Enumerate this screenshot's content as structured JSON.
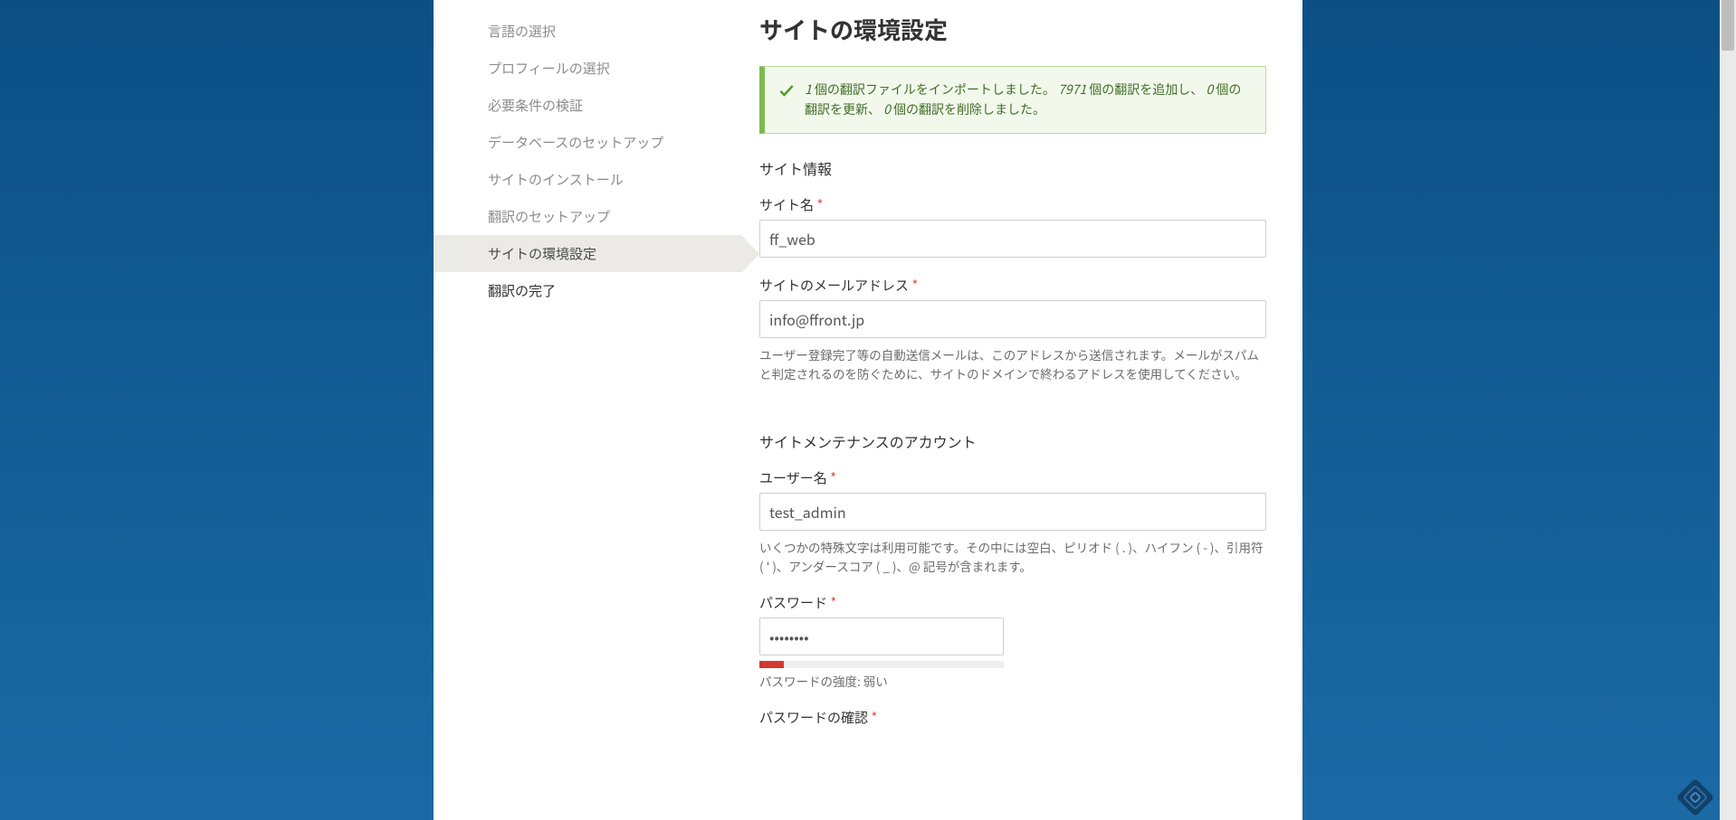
{
  "page_title": "サイトの環境設定",
  "sidebar": {
    "steps": [
      {
        "label": "言語の選択",
        "state": "past"
      },
      {
        "label": "プロフィールの選択",
        "state": "past"
      },
      {
        "label": "必要条件の検証",
        "state": "past"
      },
      {
        "label": "データベースのセットアップ",
        "state": "past"
      },
      {
        "label": "サイトのインストール",
        "state": "past"
      },
      {
        "label": "翻訳のセットアップ",
        "state": "past"
      },
      {
        "label": "サイトの環境設定",
        "state": "active"
      },
      {
        "label": "翻訳の完了",
        "state": "future"
      }
    ]
  },
  "message": {
    "p1a": "1",
    "p1b": " 個の翻訳ファイルをインポートしました。",
    "p2a": "7971",
    "p2b": " 個の翻訳を追加し、",
    "p3a": "0",
    "p3b": " 個の翻訳を更新、",
    "p4a": "0",
    "p4b": " 個の翻訳を削除しました。"
  },
  "sections": {
    "site_info": "サイト情報",
    "maintenance_account": "サイトメンテナンスのアカウント"
  },
  "fields": {
    "site_name": {
      "label": "サイト名",
      "value": "ff_web"
    },
    "site_email": {
      "label": "サイトのメールアドレス",
      "value": "info@ffront.jp",
      "help": "ユーザー登録完了等の自動送信メールは、このアドレスから送信されます。メールがスパムと判定されるのを防ぐために、サイトのドメインで終わるアドレスを使用してください。"
    },
    "username": {
      "label": "ユーザー名",
      "value": "test_admin",
      "help": "いくつかの特殊文字は利用可能です。その中には空白、ピリオド ( . )、ハイフン ( - )、引用符 ( ' )、アンダースコア ( _ )、@ 記号が含まれます。"
    },
    "password": {
      "label": "パスワード",
      "value": "••••••••",
      "strength_label": "パスワードの強度: ",
      "strength_value": "弱い",
      "strength_percent": 10,
      "strength_color": "#d33a2e"
    },
    "password_confirm": {
      "label": "パスワードの確認"
    }
  },
  "required_marker": "*"
}
